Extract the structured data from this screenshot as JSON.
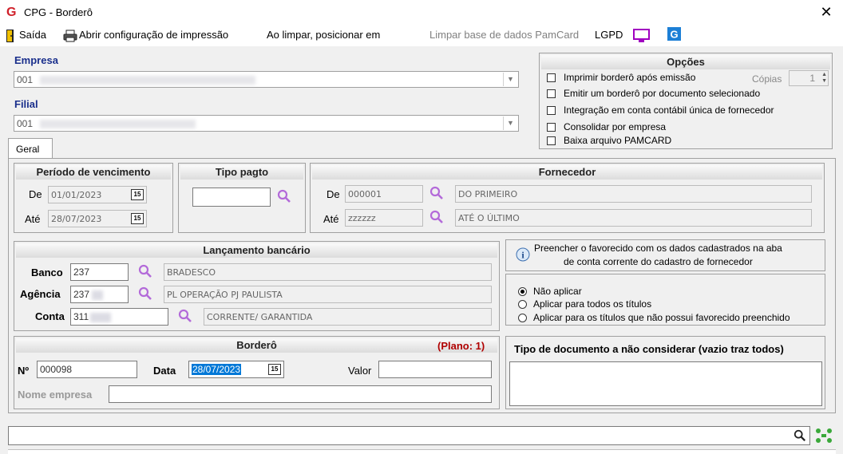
{
  "window": {
    "title": "CPG - Borderô",
    "close_glyph": "✕",
    "logo_glyph": "G"
  },
  "menubar": {
    "saida": "Saída",
    "abrir_config": "Abrir configuração de impressão",
    "ao_limpar": "Ao limpar, posicionar em",
    "limpar_base": "Limpar base de dados PamCard",
    "lgpd": "LGPD"
  },
  "empresa": {
    "label": "Empresa",
    "value": "001"
  },
  "filial": {
    "label": "Filial",
    "value": "001"
  },
  "tabs": [
    {
      "label": "Geral"
    }
  ],
  "opcoes": {
    "title": "Opções",
    "copias_label": "Cópias",
    "copias_value": "1",
    "items": [
      {
        "label": "Imprimir borderô após emissão",
        "checked": false
      },
      {
        "label": "Emitir um borderô por documento selecionado",
        "checked": false
      },
      {
        "label": "Integração em conta contábil única de fornecedor",
        "checked": false
      },
      {
        "label": "Consolidar por empresa",
        "checked": false
      },
      {
        "label": "Baixa arquivo PAMCARD",
        "checked": false
      }
    ]
  },
  "periodo": {
    "title": "Período de vencimento",
    "de_label": "De",
    "de_value": "01/01/2023",
    "ate_label": "Até",
    "ate_value": "28/07/2023",
    "cal_glyph": "15"
  },
  "tipo_pagto": {
    "title": "Tipo pagto",
    "value": ""
  },
  "fornecedor": {
    "title": "Fornecedor",
    "de_label": "De",
    "de_code": "000001",
    "de_name": "DO PRIMEIRO",
    "ate_label": "Até",
    "ate_code": "zzzzzz",
    "ate_name": "ATÉ O ÚLTIMO"
  },
  "lancamento": {
    "title": "Lançamento bancário",
    "banco_label": "Banco",
    "banco_value": "237",
    "banco_name": "BRADESCO",
    "agencia_label": "Agência",
    "agencia_value": "237",
    "agencia_name": "PL OPERAÇÃO PJ PAULISTA",
    "conta_label": "Conta",
    "conta_value": "311",
    "conta_name": "CORRENTE/ GARANTIDA"
  },
  "favorecido": {
    "info_line1": "Preencher o favorecido com os dados cadastrados na aba",
    "info_line2": "de conta corrente do cadastro de fornecedor",
    "options": [
      {
        "label": "Não aplicar",
        "selected": true
      },
      {
        "label": "Aplicar para todos os títulos",
        "selected": false
      },
      {
        "label": "Aplicar para os títulos que não possui favorecido preenchido",
        "selected": false
      }
    ]
  },
  "bordero": {
    "title": "Borderô",
    "plano": "(Plano: 1)",
    "num_label": "Nº",
    "num_value": "000098",
    "data_label": "Data",
    "data_value": "28/07/2023",
    "valor_label": "Valor",
    "valor_value": "",
    "nome_empresa_label": "Nome empresa",
    "nome_empresa_value": ""
  },
  "tipo_doc": {
    "title": "Tipo de documento a não considerar (vazio traz todos)",
    "value": ""
  },
  "search": {
    "value": ""
  },
  "colors": {
    "accent": "#b36ad9",
    "title_blue": "#1a2f8c",
    "plano_red": "#b00000",
    "lgpd_purple": "#a000c0"
  }
}
